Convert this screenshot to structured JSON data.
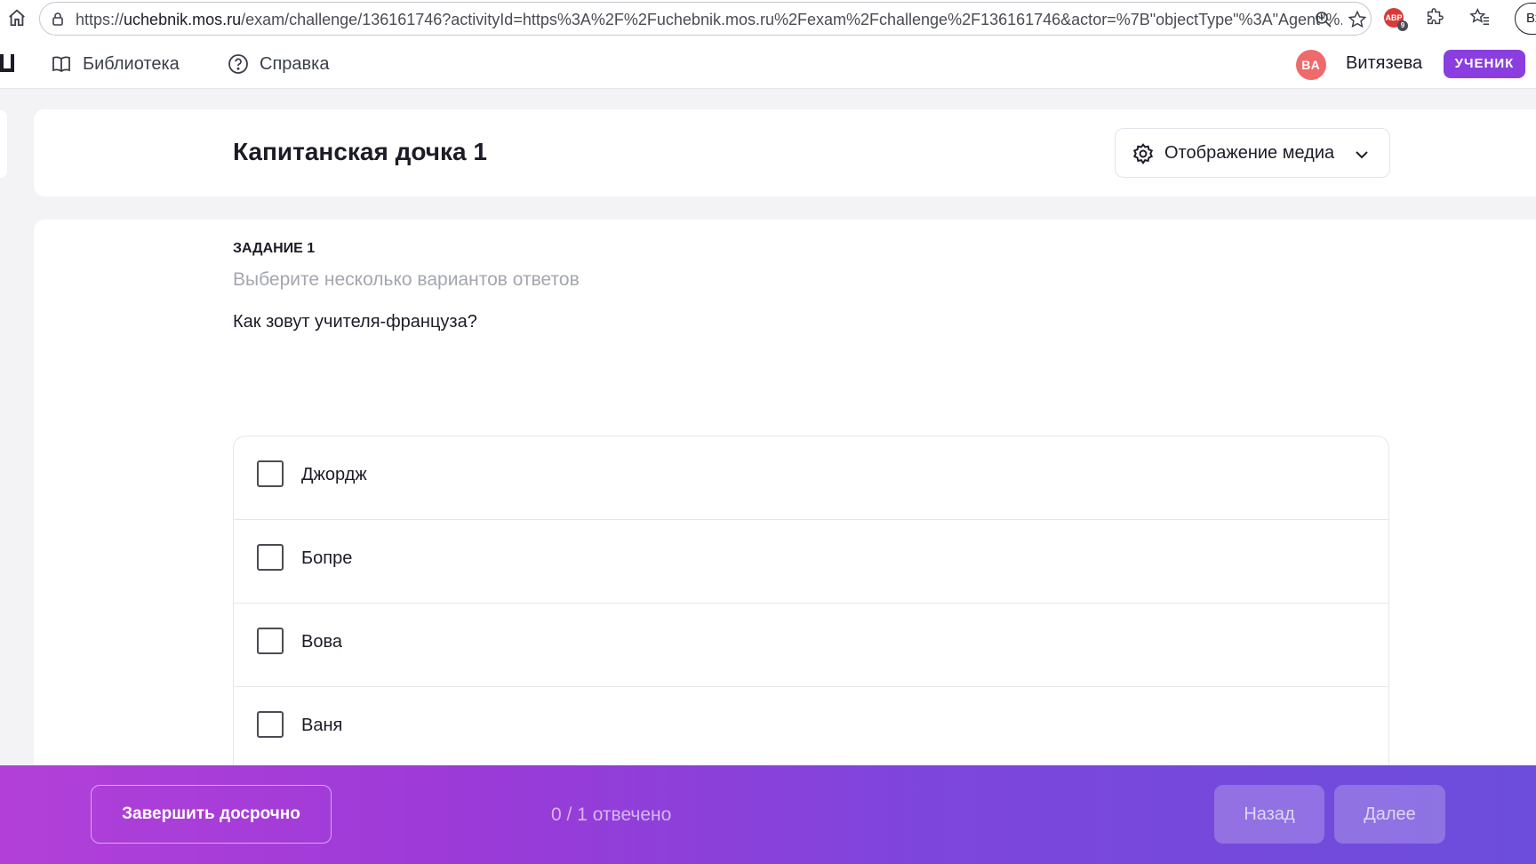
{
  "browser": {
    "url_scheme": "https://",
    "url_host": "uchebnik.mos.ru",
    "url_path": "/exam/challenge/136161746?activityId=https%3A%2F%2Fuchebnik.mos.ru%2Fexam%2Fchallenge%2F136161746&actor=%7B\"objectType\"%3A\"Agent\"%...",
    "extension_badge": "9",
    "extension_label": "ABP",
    "signin_label": "Вход"
  },
  "header": {
    "nav": [
      {
        "label": "Библиотека",
        "icon": "book-icon"
      },
      {
        "label": "Справка",
        "icon": "help-circle-icon"
      }
    ],
    "avatar_initials": "ВА",
    "user_name": "Витязева",
    "role": "УЧЕНИК"
  },
  "title_card": {
    "title": "Капитанская дочка 1",
    "media_dropdown": "Отображение медиа"
  },
  "task": {
    "number_label": "ЗАДАНИЕ 1",
    "hint": "Выберите несколько вариантов ответов",
    "question": "Как зовут учителя-француза?",
    "options": [
      {
        "label": "Джордж",
        "checked": false
      },
      {
        "label": "Бопре",
        "checked": false
      },
      {
        "label": "Вова",
        "checked": false
      },
      {
        "label": "Ваня",
        "checked": false
      }
    ]
  },
  "footer": {
    "finish_label": "Завершить досрочно",
    "progress": "0 / 1 отвечено",
    "back_label": "Назад",
    "next_label": "Далее"
  },
  "colors": {
    "role_badge": "#8a3ee0",
    "avatar": "#ef6a6a",
    "footer_gradient_start": "#b240d8",
    "footer_gradient_end": "#6c4ddc"
  }
}
